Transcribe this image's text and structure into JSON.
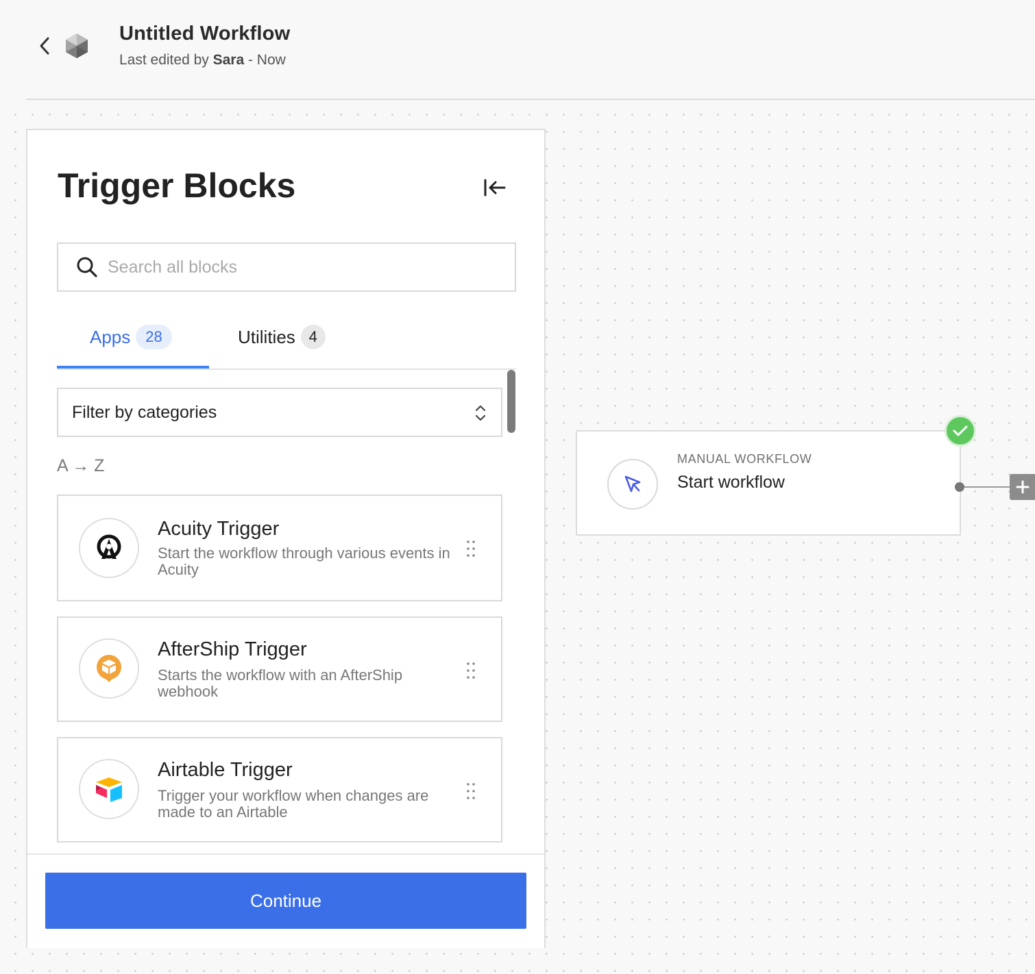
{
  "header": {
    "title": "Untitled Workflow",
    "edited_prefix": "Last edited by ",
    "edited_by": "Sara",
    "edited_suffix": " - Now"
  },
  "panel": {
    "title": "Trigger Blocks",
    "search_placeholder": "Search all blocks",
    "tabs": [
      {
        "label": "Apps",
        "count": "28",
        "active": true
      },
      {
        "label": "Utilities",
        "count": "4",
        "active": false
      }
    ],
    "filter_label": "Filter by categories",
    "sort_label": "A → Z",
    "cards": [
      {
        "title": "Acuity Trigger",
        "description": "Start the workflow through various events in Acuity",
        "icon": "acuity-logo-icon"
      },
      {
        "title": "AfterShip Trigger",
        "description": "Starts the workflow with an AfterShip webhook",
        "icon": "aftership-logo-icon"
      },
      {
        "title": "Airtable Trigger",
        "description": "Trigger your workflow when changes are made to an Airtable",
        "icon": "airtable-logo-icon"
      }
    ],
    "continue_label": "Continue"
  },
  "canvas": {
    "node": {
      "kicker": "MANUAL WORKFLOW",
      "title": "Start workflow",
      "icon": "cursor-icon",
      "status": "check-icon"
    }
  },
  "colors": {
    "accent": "#3b6fe8",
    "success": "#5ec85f",
    "aftership": "#f2a33a"
  }
}
